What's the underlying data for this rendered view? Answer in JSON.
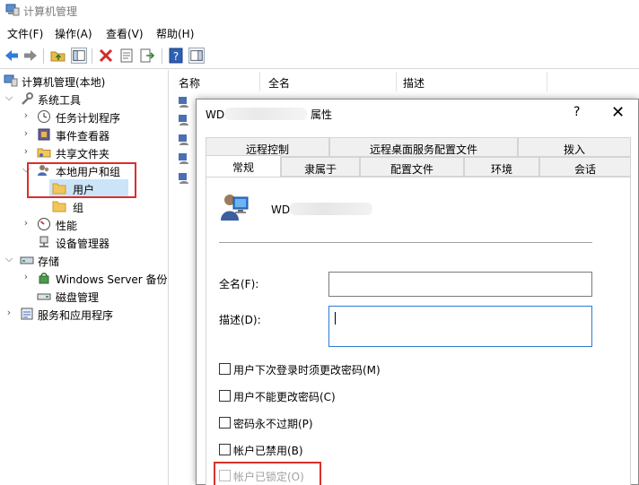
{
  "window": {
    "title": "计算机管理"
  },
  "menu": [
    "文件(F)",
    "操作(A)",
    "查看(V)",
    "帮助(H)"
  ],
  "tree": {
    "root": "计算机管理(本地)",
    "system_tools": "系统工具",
    "task_scheduler": "任务计划程序",
    "event_viewer": "事件查看器",
    "shared_folders": "共享文件夹",
    "local_users_groups": "本地用户和组",
    "users": "用户",
    "groups": "组",
    "performance": "性能",
    "device_manager": "设备管理器",
    "storage": "存储",
    "windows_server_backup": "Windows Server 备份",
    "disk_management": "磁盘管理",
    "services_apps": "服务和应用程序"
  },
  "list": {
    "columns": [
      "名称",
      "全名",
      "描述"
    ]
  },
  "dialog": {
    "title_prefix": "WD",
    "title_suffix": "属性",
    "help": "?",
    "close": "✕",
    "tabs_back": [
      "远程控制",
      "远程桌面服务配置文件",
      "拨入"
    ],
    "tabs_front": [
      "常规",
      "隶属于",
      "配置文件",
      "环境",
      "会话"
    ],
    "active_tab": "常规",
    "username_prefix": "WD",
    "fullname_label": "全名(F):",
    "fullname_value": "",
    "description_label": "描述(D):",
    "description_value": "",
    "checkboxes": [
      {
        "label": "用户下次登录时须更改密码(M)",
        "checked": false,
        "enabled": true
      },
      {
        "label": "用户不能更改密码(C)",
        "checked": false,
        "enabled": true
      },
      {
        "label": "密码永不过期(P)",
        "checked": false,
        "enabled": true
      },
      {
        "label": "帐户已禁用(B)",
        "checked": false,
        "enabled": true
      },
      {
        "label": "帐户已锁定(O)",
        "checked": false,
        "enabled": false
      }
    ]
  },
  "colors": {
    "highlight_red": "#d9302c",
    "focus_blue": "#2b7cd3",
    "folder": "#f3c65b"
  }
}
